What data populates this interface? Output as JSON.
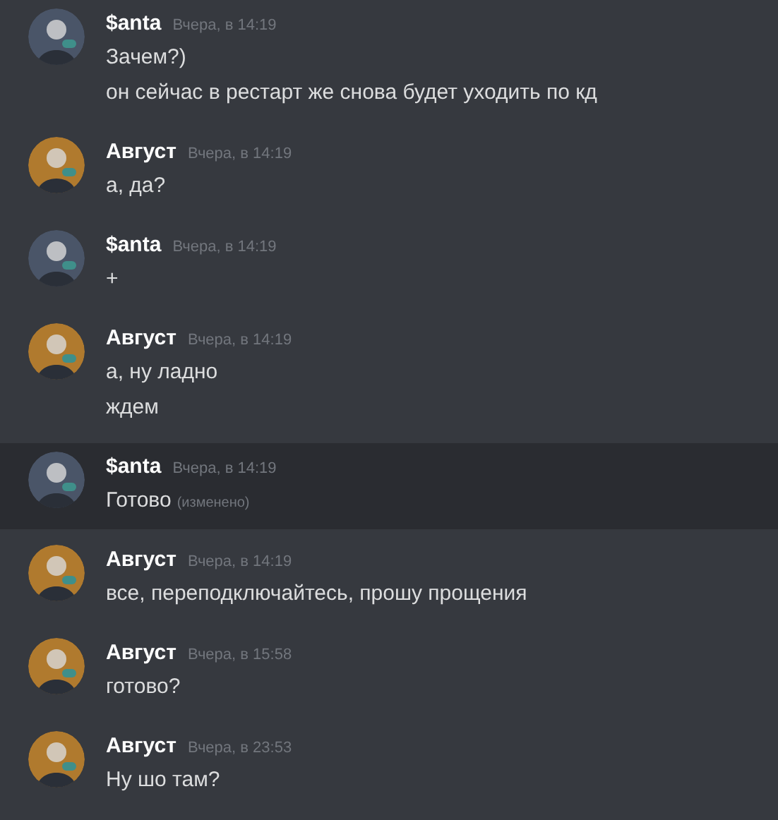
{
  "messages": [
    {
      "author": "$anta",
      "timestamp": "Вчера, в 14:19",
      "color": "#4a5568",
      "highlighted": false,
      "lines": [
        {
          "text": "Зачем?)"
        },
        {
          "text": "он сейчас в рестарт же снова будет уходить по кд"
        }
      ]
    },
    {
      "author": "Август",
      "timestamp": "Вчера, в 14:19",
      "color": "#b07a2e",
      "highlighted": false,
      "lines": [
        {
          "text": "а, да?"
        }
      ]
    },
    {
      "author": "$anta",
      "timestamp": "Вчера, в 14:19",
      "color": "#4a5568",
      "highlighted": false,
      "lines": [
        {
          "text": "+"
        }
      ]
    },
    {
      "author": "Август",
      "timestamp": "Вчера, в 14:19",
      "color": "#b07a2e",
      "highlighted": false,
      "lines": [
        {
          "text": "а, ну ладно"
        },
        {
          "text": "ждем"
        }
      ]
    },
    {
      "author": "$anta",
      "timestamp": "Вчера, в 14:19",
      "color": "#4a5568",
      "highlighted": true,
      "lines": [
        {
          "text": "Готово",
          "edited": "(изменено)"
        }
      ]
    },
    {
      "author": "Август",
      "timestamp": "Вчера, в 14:19",
      "color": "#b07a2e",
      "highlighted": false,
      "lines": [
        {
          "text": "все, переподключайтесь, прошу прощения"
        }
      ]
    },
    {
      "author": "Август",
      "timestamp": "Вчера, в 15:58",
      "color": "#b07a2e",
      "highlighted": false,
      "lines": [
        {
          "text": "готово?"
        }
      ]
    },
    {
      "author": "Август",
      "timestamp": "Вчера, в 23:53",
      "color": "#b07a2e",
      "highlighted": false,
      "lines": [
        {
          "text": "Ну шо там?"
        }
      ]
    }
  ]
}
